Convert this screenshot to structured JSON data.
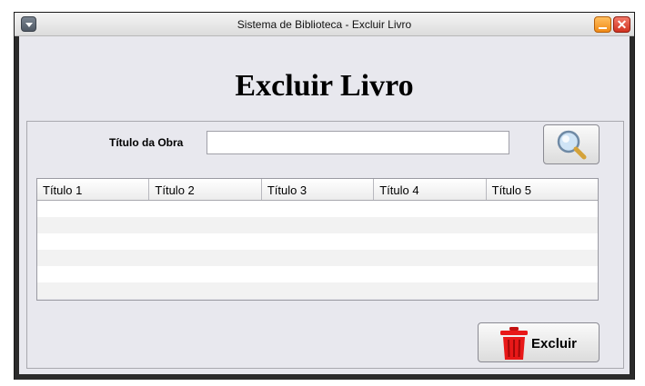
{
  "window": {
    "title": "Sistema de Biblioteca - Excluir Livro"
  },
  "page": {
    "heading": "Excluir Livro"
  },
  "search": {
    "label": "Título da Obra",
    "value": "",
    "placeholder": ""
  },
  "table": {
    "columns": [
      "Título 1",
      "Título 2",
      "Título 3",
      "Título 4",
      "Título 5"
    ],
    "rows": [
      [
        "",
        "",
        "",
        "",
        ""
      ],
      [
        "",
        "",
        "",
        "",
        ""
      ],
      [
        "",
        "",
        "",
        "",
        ""
      ],
      [
        "",
        "",
        "",
        "",
        ""
      ],
      [
        "",
        "",
        "",
        "",
        ""
      ]
    ]
  },
  "actions": {
    "delete_label": "Excluir"
  },
  "icons": {
    "search": "magnifier-icon",
    "delete": "trash-icon"
  },
  "colors": {
    "trash": "#e81818",
    "minimize": "#f08a16",
    "close": "#d1321f"
  }
}
